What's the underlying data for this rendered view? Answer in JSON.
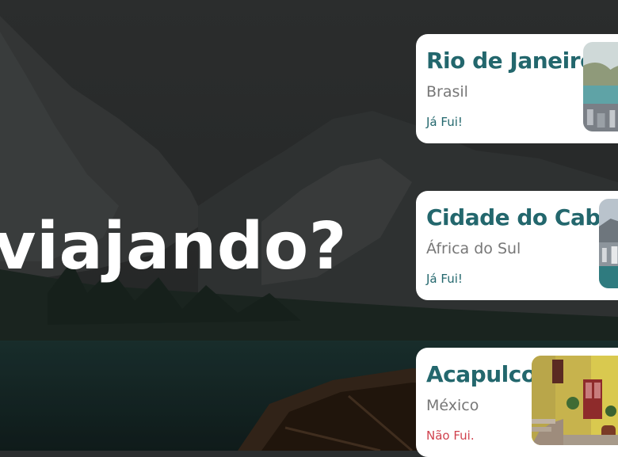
{
  "hero": {
    "text": "viajando?"
  },
  "destinations": [
    {
      "name": "Rio de Janeiro",
      "country": "Brasil",
      "status": "Já Fui!",
      "visited": true
    },
    {
      "name": "Cidade do Cabo",
      "country": "África do Sul",
      "status": "Já Fui!",
      "visited": true
    },
    {
      "name": "Acapulco",
      "country": "México",
      "status": "Não Fui.",
      "visited": false
    }
  ],
  "colors": {
    "accent": "#23676d",
    "not_visited": "#d0424e",
    "country_text": "#777777",
    "card_bg": "#ffffff"
  }
}
